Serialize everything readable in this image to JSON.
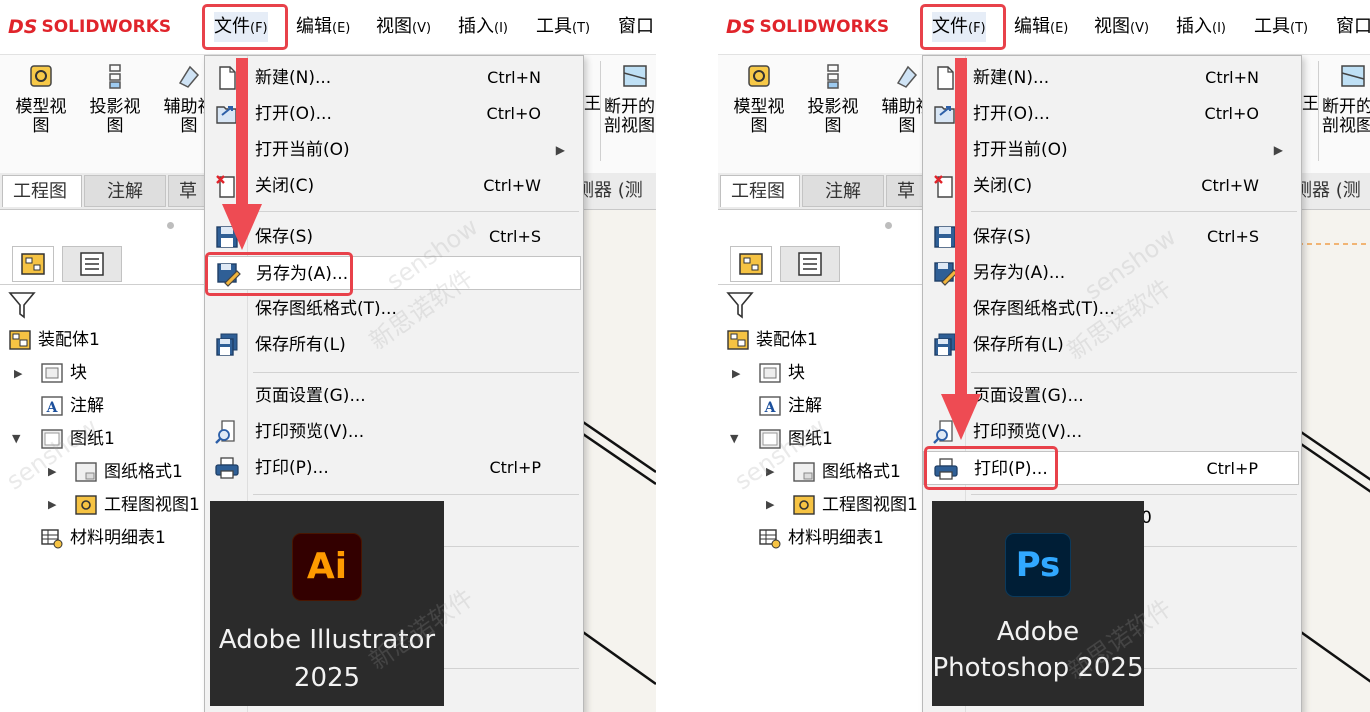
{
  "colors": {
    "brand_red": "#e0242b",
    "highlight_red": "#e8414a",
    "arrow_red": "#ee4b53",
    "ai_orange": "#ff9a00",
    "ai_bg": "#330000",
    "ps_blue": "#31a8ff",
    "ps_bg": "#001e36"
  },
  "menubar": {
    "logo_ds": "DS",
    "logo_text": "SOLIDWORKS",
    "items": [
      {
        "label": "文件",
        "key": "(F)"
      },
      {
        "label": "编辑",
        "key": "(E)"
      },
      {
        "label": "视图",
        "key": "(V)"
      },
      {
        "label": "插入",
        "key": "(I)"
      },
      {
        "label": "工具",
        "key": "(T)"
      },
      {
        "label": "窗口",
        "key": ""
      }
    ]
  },
  "toolbar": {
    "buttons": [
      {
        "line1": "模型视",
        "line2": "图",
        "icon": "model-view-icon"
      },
      {
        "line1": "投影视",
        "line2": "图",
        "icon": "projected-view-icon"
      },
      {
        "line1": "辅助视",
        "line2": "图",
        "icon": "auxiliary-view-icon"
      }
    ],
    "right_fragment": "王",
    "right_button": {
      "line1": "断开的",
      "line2": "剖视图",
      "icon": "broken-section-icon"
    }
  },
  "tabs": {
    "items": [
      "工程图",
      "注解",
      "草"
    ],
    "right_fragment": "测器 (测"
  },
  "tree": {
    "items": [
      {
        "label": "装配体1",
        "icon": "assembly-icon"
      },
      {
        "label": "块",
        "icon": "block-icon"
      },
      {
        "label": "注解",
        "icon": "annotation-icon"
      },
      {
        "label": "图纸1",
        "icon": "sheet-icon"
      },
      {
        "label": "图纸格式1",
        "icon": "sheet-format-icon"
      },
      {
        "label": "工程图视图1",
        "icon": "drawing-view-icon"
      },
      {
        "label": "材料明细表1",
        "icon": "bom-table-icon"
      }
    ]
  },
  "file_menu": {
    "items": [
      {
        "label": "新建(N)...",
        "shortcut": "Ctrl+N",
        "icon": "new-document-icon"
      },
      {
        "label": "打开(O)...",
        "shortcut": "Ctrl+O",
        "icon": "open-folder-icon"
      },
      {
        "label": "打开当前(O)",
        "shortcut": "",
        "icon": ""
      },
      {
        "label": "关闭(C)",
        "shortcut": "Ctrl+W",
        "icon": "close-document-icon"
      },
      {
        "label": "保存(S)",
        "shortcut": "Ctrl+S",
        "icon": "save-disk-icon"
      },
      {
        "label": "另存为(A)...",
        "shortcut": "",
        "icon": "save-as-icon"
      },
      {
        "label": "保存图纸格式(T)...",
        "shortcut": "",
        "icon": ""
      },
      {
        "label": "保存所有(L)",
        "shortcut": "",
        "icon": "save-all-icon"
      },
      {
        "label": "页面设置(G)...",
        "shortcut": "",
        "icon": ""
      },
      {
        "label": "打印预览(V)...",
        "shortcut": "",
        "icon": "print-preview-icon"
      },
      {
        "label": "打印(P)...",
        "shortcut": "Ctrl+P",
        "icon": "printer-icon"
      }
    ],
    "right_partial_label": "0"
  },
  "badges": {
    "left": {
      "logo_text": "Ai",
      "name_line1": "Adobe Illustrator",
      "name_line2": "2025"
    },
    "right": {
      "logo_text": "Ps",
      "name_line1": "Adobe",
      "name_line2": "Photoshop 2025"
    }
  },
  "watermark": {
    "latin": "senshow",
    "cjk": "新思诺软件"
  }
}
